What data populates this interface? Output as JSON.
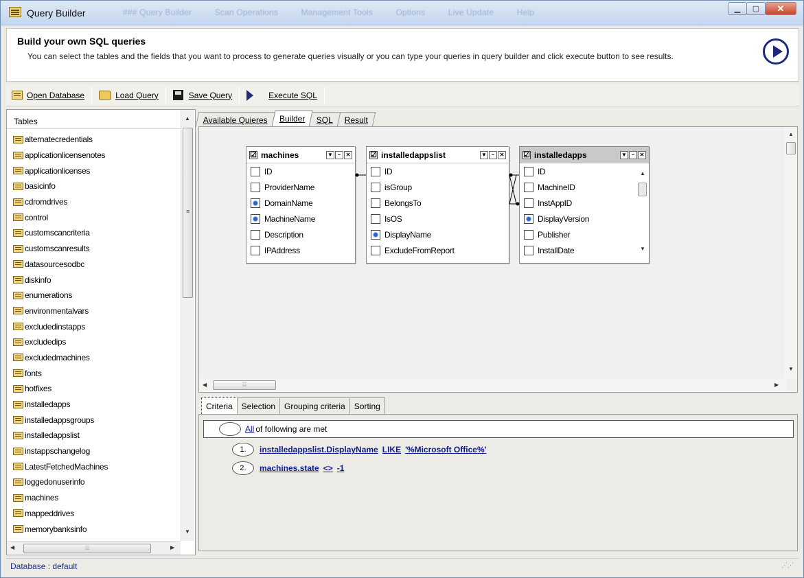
{
  "window": {
    "title": "Query Builder",
    "ghost_menu": [
      "### Query Builder",
      "Scan Operations",
      "Management Tools",
      "Options",
      "Live Update",
      "Help"
    ]
  },
  "header": {
    "title": "Build your own SQL queries",
    "description": "You can select the tables and the fields that you want to process to generate queries visually or you can type your queries in query builder and click execute button to see results."
  },
  "toolbar": {
    "open_database": "Open Database",
    "load_query": "Load Query",
    "save_query": "Save Query",
    "execute_sql": "Execute SQL"
  },
  "tables_panel": {
    "header": "Tables",
    "items": [
      "alternatecredentials",
      "applicationlicensenotes",
      "applicationlicenses",
      "basicinfo",
      "cdromdrives",
      "control",
      "customscancriteria",
      "customscanresults",
      "datasourcesodbc",
      "diskinfo",
      "enumerations",
      "environmentalvars",
      "excludedinstapps",
      "excludedips",
      "excludedmachines",
      "fonts",
      "hotfixes",
      "installedapps",
      "installedappsgroups",
      "installedappslist",
      "instappschangelog",
      "LatestFetchedMachines",
      "loggedonuserinfo",
      "machines",
      "mappeddrives",
      "memorybanksinfo"
    ]
  },
  "tabs": [
    "Available Quieres",
    "Builder",
    "SQL",
    "Result"
  ],
  "active_tab": "Builder",
  "table_boxes": [
    {
      "name": "machines",
      "checked": "☑",
      "fields": [
        {
          "label": "ID",
          "selected": false
        },
        {
          "label": "ProviderName",
          "selected": false
        },
        {
          "label": "DomainName",
          "selected": true
        },
        {
          "label": "MachineName",
          "selected": true
        },
        {
          "label": "Description",
          "selected": false
        },
        {
          "label": "IPAddress",
          "selected": false
        }
      ]
    },
    {
      "name": "installedappslist",
      "checked": "☑",
      "fields": [
        {
          "label": "ID",
          "selected": false
        },
        {
          "label": "isGroup",
          "selected": false
        },
        {
          "label": "BelongsTo",
          "selected": false
        },
        {
          "label": "IsOS",
          "selected": false
        },
        {
          "label": "DisplayName",
          "selected": true
        },
        {
          "label": "ExcludeFromReport",
          "selected": false
        }
      ]
    },
    {
      "name": "installedapps",
      "checked": "☑",
      "fields": [
        {
          "label": "ID",
          "selected": false
        },
        {
          "label": "MachineID",
          "selected": false
        },
        {
          "label": "InstAppID",
          "selected": false
        },
        {
          "label": "DisplayVersion",
          "selected": true
        },
        {
          "label": "Publisher",
          "selected": false
        },
        {
          "label": "InstallDate",
          "selected": false
        }
      ]
    }
  ],
  "bottom_tabs": [
    "Criteria",
    "Selection",
    "Grouping criteria",
    "Sorting"
  ],
  "criteria": {
    "all_label": "All",
    "all_suffix": "of following are met",
    "rows": [
      {
        "num": "1.",
        "field": "installedappslist.DisplayName",
        "op": "LIKE",
        "value": "'%Microsoft Office%'"
      },
      {
        "num": "2.",
        "field": "machines.state",
        "op": "<>",
        "value": "-1"
      }
    ]
  },
  "status": {
    "text": "Database : default"
  },
  "icons": [
    "app-icon",
    "database-icon",
    "folder-icon",
    "save-icon",
    "play-icon",
    "table-icon"
  ]
}
